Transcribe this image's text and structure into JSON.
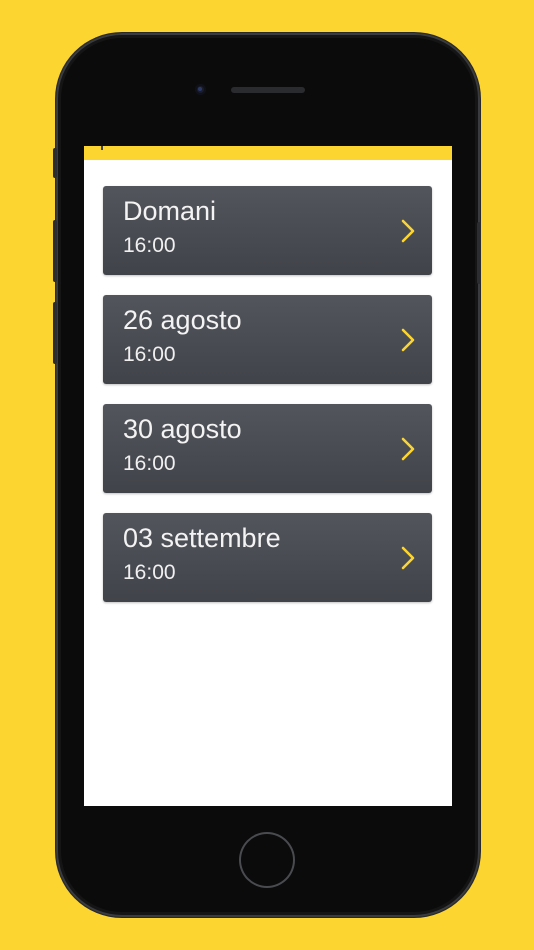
{
  "colors": {
    "background": "#FCD531",
    "card": "#4A4C53",
    "accent": "#FCD531",
    "text": "#F3F3F3"
  },
  "items": [
    {
      "title": "Domani",
      "time": "16:00",
      "icon": "chevron-right-icon"
    },
    {
      "title": "26 agosto",
      "time": "16:00",
      "icon": "chevron-right-icon"
    },
    {
      "title": "30 agosto",
      "time": "16:00",
      "icon": "chevron-right-icon"
    },
    {
      "title": "03 settembre",
      "time": "16:00",
      "icon": "chevron-right-icon"
    }
  ]
}
